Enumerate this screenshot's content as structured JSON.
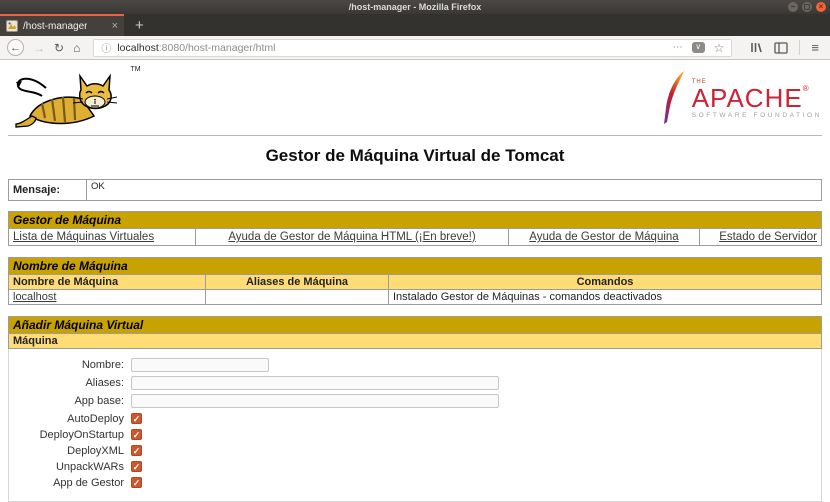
{
  "window": {
    "title": "/host-manager - Mozilla Firefox",
    "controls": {
      "minimize": "−",
      "maximize": "◻",
      "close": "×"
    }
  },
  "browser": {
    "tab_title": "/host-manager",
    "url_host": "localhost",
    "url_rest": ":8080/host-manager/html"
  },
  "icons": {
    "back": "←",
    "forward": "→",
    "reload": "↻",
    "home": "⌂",
    "info": "ⓘ",
    "dots": "⋯",
    "star": "☆",
    "menu": "≡",
    "plus": "+",
    "tab_close": "×",
    "pocket": "∨"
  },
  "logos": {
    "tomcat_tm": "TM",
    "apache": {
      "the": "THE",
      "name": "APACHE",
      "reg": "®",
      "subtitle": "SOFTWARE FOUNDATION"
    }
  },
  "page": {
    "heading": "Gestor de Máquina Virtual de Tomcat",
    "message": {
      "label": "Mensaje:",
      "value": "OK"
    },
    "manager": {
      "title": "Gestor de Máquina",
      "links": [
        {
          "label": "Lista de Máquinas Virtuales"
        },
        {
          "label": "Ayuda de Gestor de Máquina HTML (¡En breve!)"
        },
        {
          "label": "Ayuda de Gestor de Máquina"
        },
        {
          "label": "Estado de Servidor"
        }
      ]
    },
    "hosts": {
      "title": "Nombre de Máquina",
      "columns": [
        "Nombre de Máquina",
        "Aliases de Máquina",
        "Comandos"
      ],
      "rows": [
        {
          "name": "localhost",
          "aliases": "",
          "commands": "Instalado Gestor de Máquinas - comandos deactivados"
        }
      ]
    },
    "add_host": {
      "title": "Añadir Máquina Virtual",
      "subtitle": "Máquina",
      "fields": [
        {
          "label": "Nombre:",
          "value": ""
        },
        {
          "label": "Aliases:",
          "value": ""
        },
        {
          "label": "App base:",
          "value": ""
        }
      ],
      "checkboxes": [
        {
          "label": "AutoDeploy",
          "checked": true
        },
        {
          "label": "DeployOnStartup",
          "checked": true
        },
        {
          "label": "DeployXML",
          "checked": true
        },
        {
          "label": "UnpackWARs",
          "checked": true
        },
        {
          "label": "App de Gestor",
          "checked": true
        }
      ]
    }
  },
  "colors": {
    "section_header_bg": "#C8A200",
    "column_header_bg": "#FFDC75",
    "tab_accent": "#EA6148",
    "close_button": "#EF6438",
    "checkbox_checked": "#D4542C",
    "apache_red": "#CD2335"
  }
}
